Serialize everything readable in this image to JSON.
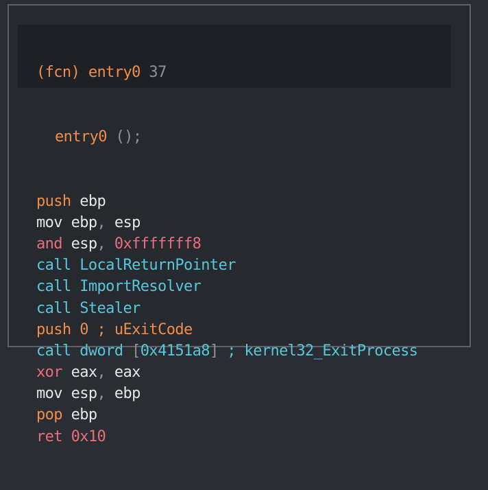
{
  "header": {
    "fcn_tag": "(fcn)",
    "func_name": "entry0",
    "func_size": "37",
    "signature_name": "entry0",
    "signature_args": "();"
  },
  "instructions": [
    {
      "mnemonic": "push",
      "operands": "ebp",
      "color": "#f08d49"
    },
    {
      "mnemonic": "mov",
      "operands": "ebp, esp",
      "color": "#e6e6e6"
    },
    {
      "mnemonic": "and",
      "operands": "esp, 0xfffffff8",
      "color": "#e76f7b"
    },
    {
      "mnemonic": "call",
      "operands": "LocalReturnPointer",
      "color": "#56c7d8"
    },
    {
      "mnemonic": "call",
      "operands": "ImportResolver",
      "color": "#56c7d8"
    },
    {
      "mnemonic": "call",
      "operands": "Stealer",
      "color": "#56c7d8"
    },
    {
      "mnemonic": "push",
      "operands": "0 ; uExitCode",
      "color": "#f08d49"
    },
    {
      "mnemonic": "call",
      "operands": "dword [0x4151a8] ; kernel32_ExitProcess",
      "color": "#56c7d8"
    },
    {
      "mnemonic": "xor",
      "operands": "eax, eax",
      "color": "#e76f7b"
    },
    {
      "mnemonic": "mov",
      "operands": "esp, ebp",
      "color": "#e6e6e6"
    },
    {
      "mnemonic": "pop",
      "operands": "ebp",
      "color": "#f08d49"
    },
    {
      "mnemonic": "ret",
      "operands": "0x10",
      "color": "#e76f7b"
    }
  ]
}
